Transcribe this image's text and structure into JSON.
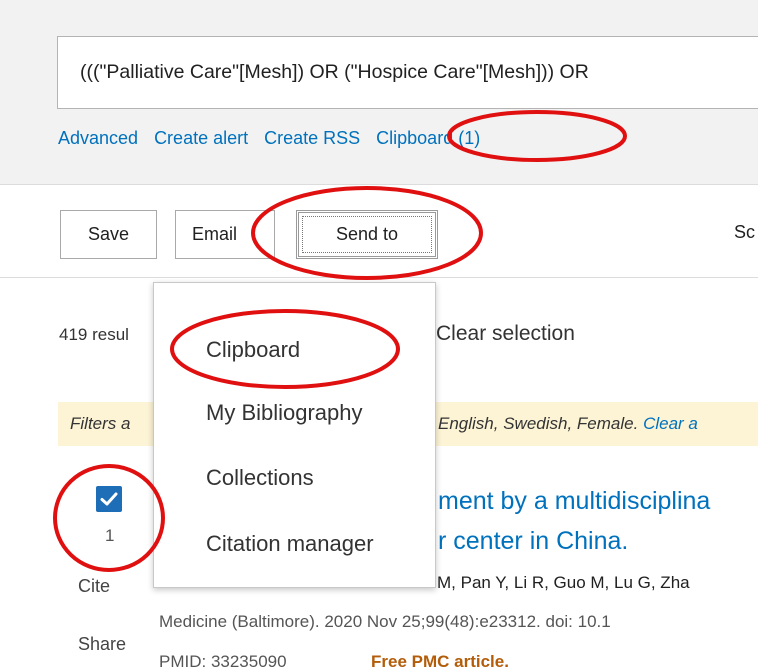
{
  "search": {
    "query": "(((\"Palliative Care\"[Mesh]) OR (\"Hospice Care\"[Mesh])) OR",
    "links": [
      "Advanced",
      "Create alert",
      "Create RSS",
      "Clipboard (1)"
    ]
  },
  "toolbar": {
    "save_label": "Save",
    "email_label": "Email",
    "send_to_label": "Send to",
    "sort_label_partial": "Sc"
  },
  "send_to_menu": {
    "items": [
      "Clipboard",
      "My Bibliography",
      "Collections",
      "Citation manager"
    ]
  },
  "results": {
    "count_partial": "419 resul",
    "clear_selection": "Clear selection",
    "filters_partial": "Filters a",
    "filters_values": "English, Swedish, Female.",
    "filters_clear_partial": "Clear a",
    "item": {
      "number": "1",
      "checked": true,
      "cite_label": "Cite",
      "share_label": "Share",
      "title_line1": "ment by a multidisciplina",
      "title_line2": "r center in China.",
      "authors_partial": "M, Pan Y, Li R, Guo M, Lu G, Zha",
      "citation": "Medicine (Baltimore). 2020 Nov 25;99(48):e23312. doi: 10.1",
      "pmid": "PMID: 33235090",
      "free_pmc": "Free PMC article."
    }
  },
  "annotation_color": "#e01010",
  "colors": {
    "link": "#0071bc",
    "checkbox": "#1e6db7",
    "filters_bg": "#fdf4d6",
    "pmc": "#b35d0b"
  }
}
